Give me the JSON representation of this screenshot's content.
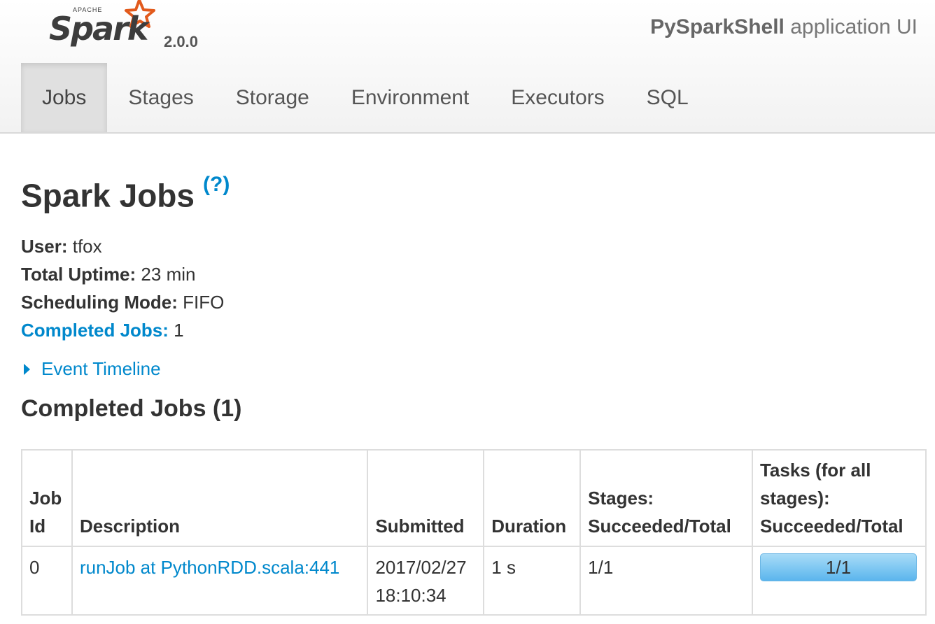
{
  "brand": {
    "name": "Spark",
    "apache": "APACHE",
    "version": "2.0.0",
    "logo_star_color": "#e25a1c"
  },
  "header": {
    "app_name": "PySparkShell",
    "app_suffix": "application UI"
  },
  "tabs": [
    {
      "label": "Jobs",
      "active": true
    },
    {
      "label": "Stages",
      "active": false
    },
    {
      "label": "Storage",
      "active": false
    },
    {
      "label": "Environment",
      "active": false
    },
    {
      "label": "Executors",
      "active": false
    },
    {
      "label": "SQL",
      "active": false
    }
  ],
  "page": {
    "title": "Spark Jobs",
    "help": "(?)",
    "user_label": "User:",
    "user_value": "tfox",
    "uptime_label": "Total Uptime:",
    "uptime_value": "23 min",
    "scheduling_label": "Scheduling Mode:",
    "scheduling_value": "FIFO",
    "completed_label": "Completed Jobs:",
    "completed_value": "1",
    "timeline_label": "Event Timeline",
    "section_title": "Completed Jobs (1)"
  },
  "table": {
    "headers": [
      "Job Id",
      "Description",
      "Submitted",
      "Duration",
      "Stages: Succeeded/Total",
      "Tasks (for all stages): Succeeded/Total"
    ],
    "rows": [
      {
        "job_id": "0",
        "description": "runJob at PythonRDD.scala:441",
        "submitted_date": "2017/02/27",
        "submitted_time": "18:10:34",
        "duration": "1 s",
        "stages": "1/1",
        "tasks": "1/1",
        "tasks_progress": 1.0
      }
    ]
  },
  "colors": {
    "link": "#0088cc",
    "progress": "#5bb5ed"
  }
}
